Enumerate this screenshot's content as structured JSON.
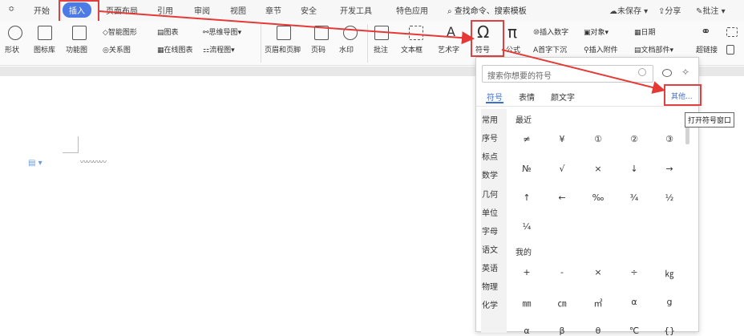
{
  "menubar": {
    "dropdown": "≎",
    "tabs": [
      "开始",
      "插入",
      "页面布局",
      "引用",
      "审阅",
      "视图",
      "章节",
      "安全",
      "开发工具",
      "特色应用"
    ],
    "active_tab": "插入",
    "search_cmd": "查找命令、搜索模板",
    "unsaved": "未保存",
    "share": "分享",
    "comment": "批注"
  },
  "ribbon": {
    "shape": "形状",
    "icon_lib": "图标库",
    "func_chart": "功能图",
    "smart_shape": "智能图形",
    "chart": "图表",
    "mind_map": "思维导图",
    "relation": "关系图",
    "online_chart": "在线图表",
    "flowchart": "流程图",
    "header_footer": "页眉和页脚",
    "page_num": "页码",
    "watermark": "水印",
    "annotation": "批注",
    "textbox": "文本框",
    "art_text": "艺术字",
    "symbol": "符号",
    "formula": "公式",
    "insert_number": "插入数字",
    "object": "对象",
    "date": "日期",
    "drop_cap": "首字下沉",
    "attachment": "插入附件",
    "doc_parts": "文档部件",
    "hyperlink": "超链接",
    "omega": "Ω",
    "pi": "π"
  },
  "panel": {
    "search_placeholder": "搜索你想要的符号",
    "tabs": [
      "符号",
      "表情",
      "颜文字"
    ],
    "more": "其他...",
    "tooltip": "打开符号窗口",
    "categories": [
      "常用",
      "序号",
      "标点",
      "数学",
      "几何",
      "单位",
      "字母",
      "语文",
      "英语",
      "物理",
      "化学"
    ],
    "recent_label": "最近",
    "mine_label": "我的",
    "recent_symbols": [
      "≠",
      "¥",
      "①",
      "②",
      "③",
      "№",
      "√",
      "×",
      "↓",
      "→",
      "↑",
      "←",
      "‰",
      "¾",
      "½",
      "¼"
    ],
    "my_symbols": [
      "+",
      "-",
      "×",
      "÷",
      "㎏",
      "㎜",
      "㎝",
      "㎡",
      "α",
      "g",
      "α",
      "β",
      "θ",
      "℃",
      "{}"
    ]
  }
}
